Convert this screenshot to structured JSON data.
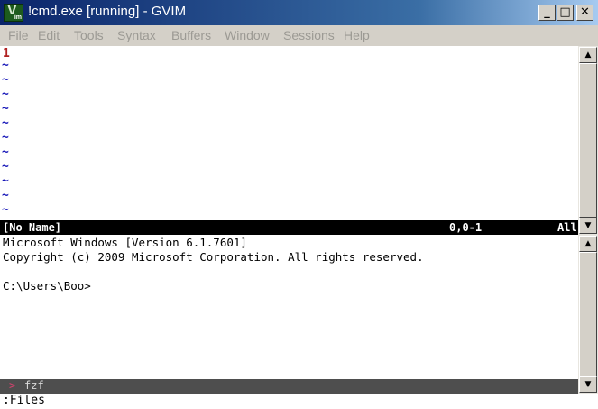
{
  "window": {
    "title": "!cmd.exe [running] - GVIM",
    "icon": "vim-icon",
    "buttons": {
      "minimize": "_",
      "maximize": "□",
      "close": "✕"
    }
  },
  "menu": [
    "File",
    "Edit",
    "Tools",
    "Syntax",
    "Buffers",
    "Window",
    "Sessions",
    "Help"
  ],
  "editor": {
    "line_number": "1",
    "tilde": "~"
  },
  "statusline": {
    "filename": "[No Name]",
    "position": "0,0-1",
    "scroll": "All"
  },
  "terminal": {
    "lines": [
      "Microsoft Windows [Version 6.1.7601]",
      "Copyright (c) 2009 Microsoft Corporation. All rights reserved.",
      "",
      "C:\\Users\\Boo>"
    ]
  },
  "fzf": {
    "arrow": ">",
    "label": "fzf"
  },
  "cmdline": ":Files",
  "scrollbar": {
    "up_arrow": "▲",
    "down_arrow": "▼"
  }
}
